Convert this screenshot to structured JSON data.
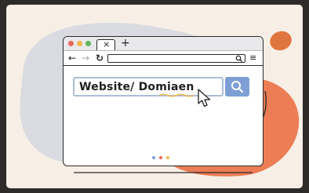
{
  "browser": {
    "window_controls": [
      {
        "name": "close",
        "color": "#e8685a"
      },
      {
        "name": "minimize",
        "color": "#f2b84a"
      },
      {
        "name": "maximize",
        "color": "#5fb85a"
      }
    ],
    "tab_close_glyph": "×",
    "new_tab_glyph": "+",
    "nav": {
      "back_glyph": "←",
      "forward_glyph": "→",
      "reload_glyph": "↻"
    },
    "address_bar": {
      "value": ""
    },
    "menu_glyph": "≡"
  },
  "search": {
    "value": "Website/ Domiaen",
    "button_icon": "search-icon",
    "button_color": "#7e9fd4"
  },
  "pager_dots": [
    "#7e9fd4",
    "#e8685a",
    "#f2b84a"
  ],
  "colors": {
    "background": "#f7efe6",
    "blob_gray": "#d9dbe0",
    "blob_orange": "#ec7d55",
    "blob_small": "#e0763f",
    "underline": "#f2b84a"
  }
}
